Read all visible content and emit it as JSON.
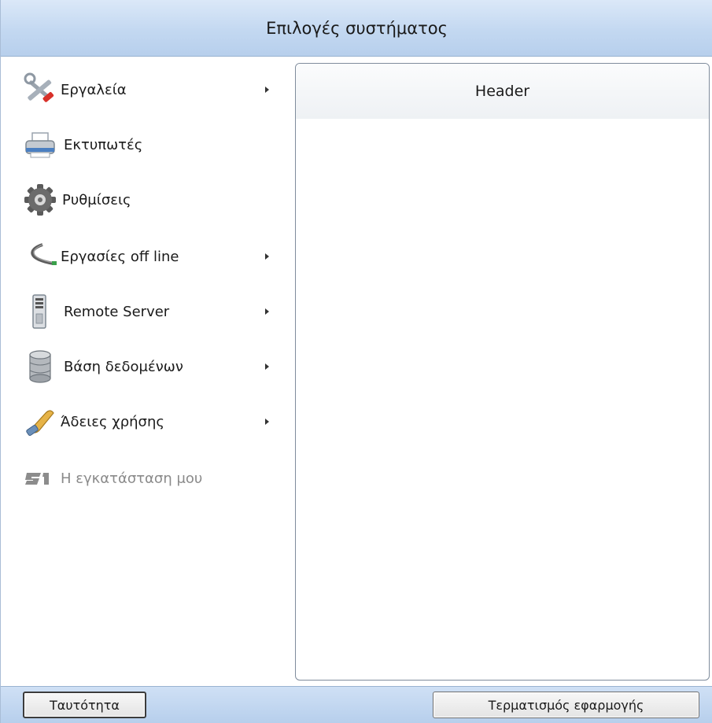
{
  "window": {
    "title": "Επιλογές συστήματος"
  },
  "menu": {
    "items": [
      {
        "label": "Εργαλεία",
        "icon": "tools-icon",
        "has_submenu": true
      },
      {
        "label": "Εκτυπωτές",
        "icon": "printer-icon",
        "has_submenu": false
      },
      {
        "label": "Ρυθμίσεις",
        "icon": "gear-icon",
        "has_submenu": false
      },
      {
        "label": "Εργασίες off line",
        "icon": "cable-icon",
        "has_submenu": true
      },
      {
        "label": "Remote Server",
        "icon": "server-icon",
        "has_submenu": true
      },
      {
        "label": "Βάση δεδομένων",
        "icon": "database-icon",
        "has_submenu": true
      },
      {
        "label": "Άδειες χρήσης",
        "icon": "license-icon",
        "has_submenu": true
      },
      {
        "label": "Η εγκατάσταση μου",
        "icon": "s1-logo-icon",
        "has_submenu": false,
        "disabled": true
      }
    ]
  },
  "panel": {
    "header": "Header"
  },
  "footer": {
    "identity_button": "Ταυτότητα",
    "exit_button": "Τερματισμός εφαρμογής"
  }
}
